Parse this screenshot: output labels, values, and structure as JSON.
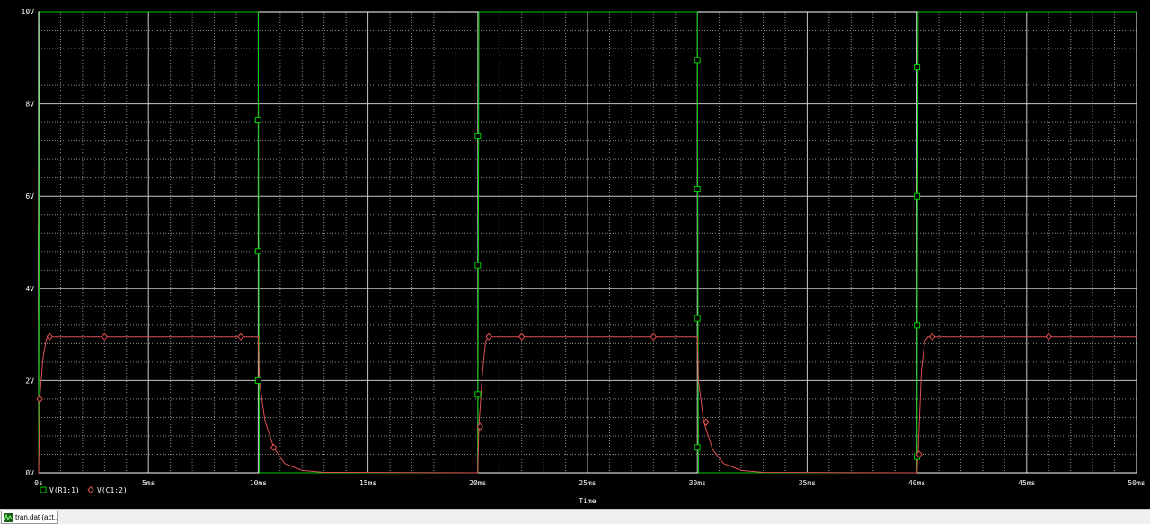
{
  "chart_data": {
    "type": "line",
    "xlabel": "Time",
    "x_ticks": [
      "0s",
      "5ms",
      "10ms",
      "15ms",
      "20ms",
      "25ms",
      "30ms",
      "35ms",
      "40ms",
      "45ms",
      "50ms"
    ],
    "y_ticks": [
      "0V",
      "2V",
      "4V",
      "6V",
      "8V",
      "10V"
    ],
    "xlim": [
      0,
      50
    ],
    "ylim": [
      0,
      10
    ],
    "x_unit_note": "ms",
    "grid": true,
    "legend_placement": "bottom-left",
    "series": [
      {
        "name": "V(R1:1)",
        "color": "#00c800",
        "marker": "square",
        "points": [
          [
            0,
            0
          ],
          [
            0.05,
            10
          ],
          [
            10,
            10
          ],
          [
            10.05,
            0
          ],
          [
            20,
            0
          ],
          [
            20.05,
            10
          ],
          [
            30,
            10
          ],
          [
            30.05,
            0
          ],
          [
            40,
            0
          ],
          [
            40.05,
            10
          ],
          [
            50,
            10
          ]
        ],
        "markers": [
          [
            10,
            7.65
          ],
          [
            10,
            4.8
          ],
          [
            10,
            2.0
          ],
          [
            20,
            7.3
          ],
          [
            20,
            4.5
          ],
          [
            20,
            1.7
          ],
          [
            30,
            8.95
          ],
          [
            30,
            6.15
          ],
          [
            30,
            3.35
          ],
          [
            30,
            0.55
          ],
          [
            40,
            8.8
          ],
          [
            40,
            6.0
          ],
          [
            40,
            3.2
          ],
          [
            40,
            0.35
          ]
        ]
      },
      {
        "name": "V(C1:2)",
        "color": "#e05050",
        "marker": "diamond",
        "points": [
          [
            0,
            0
          ],
          [
            0.05,
            1.6
          ],
          [
            0.2,
            2.5
          ],
          [
            0.35,
            2.9
          ],
          [
            0.5,
            2.95
          ],
          [
            10,
            2.95
          ],
          [
            10.05,
            2.0
          ],
          [
            10.3,
            1.15
          ],
          [
            10.7,
            0.55
          ],
          [
            11.2,
            0.2
          ],
          [
            12,
            0.05
          ],
          [
            13,
            0.01
          ],
          [
            20,
            0
          ],
          [
            20.05,
            1.0
          ],
          [
            20.2,
            2.1
          ],
          [
            20.35,
            2.85
          ],
          [
            20.5,
            2.95
          ],
          [
            30,
            2.95
          ],
          [
            30.05,
            2.0
          ],
          [
            30.3,
            1.1
          ],
          [
            30.7,
            0.5
          ],
          [
            31.2,
            0.2
          ],
          [
            32,
            0.05
          ],
          [
            33,
            0.01
          ],
          [
            40,
            0
          ],
          [
            40.05,
            0.4
          ],
          [
            40.2,
            2.2
          ],
          [
            40.35,
            2.85
          ],
          [
            40.5,
            2.95
          ],
          [
            50,
            2.95
          ]
        ],
        "markers": [
          [
            0.05,
            1.6
          ],
          [
            0.5,
            2.95
          ],
          [
            3,
            2.95
          ],
          [
            9.2,
            2.95
          ],
          [
            10.7,
            0.55
          ],
          [
            20.1,
            1.0
          ],
          [
            20.5,
            2.95
          ],
          [
            22,
            2.95
          ],
          [
            28,
            2.95
          ],
          [
            30.4,
            1.1
          ],
          [
            40.1,
            0.4
          ],
          [
            40.7,
            2.95
          ],
          [
            46,
            2.95
          ]
        ]
      }
    ]
  },
  "tab": {
    "label": "tran.dat (act..."
  },
  "icons": {
    "tab_icon": "waveform-icon"
  }
}
